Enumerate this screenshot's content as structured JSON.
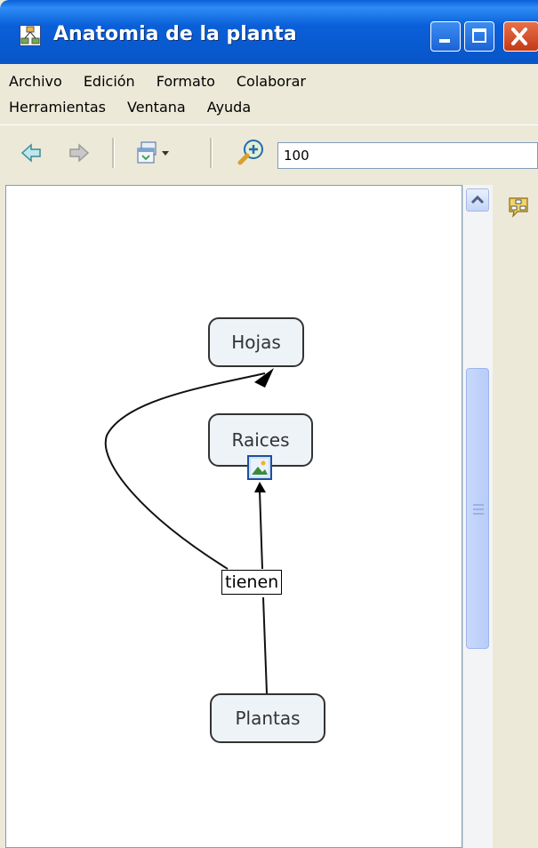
{
  "window": {
    "title": "Anatomia de la planta"
  },
  "menus": {
    "row1": [
      "Archivo",
      "Edición",
      "Formato",
      "Colaborar"
    ],
    "row2": [
      "Herramientas",
      "Ventana",
      "Ayuda"
    ]
  },
  "toolbar": {
    "zoom_value": "100"
  },
  "concept_map": {
    "nodes": {
      "hojas": "Hojas",
      "raices": "Raices",
      "plantas": "Plantas"
    },
    "link_word": "tienen"
  },
  "colors": {
    "titlebar": "#0a5fd8",
    "node_fill": "#eef3f8",
    "close_button": "#c23a14"
  }
}
